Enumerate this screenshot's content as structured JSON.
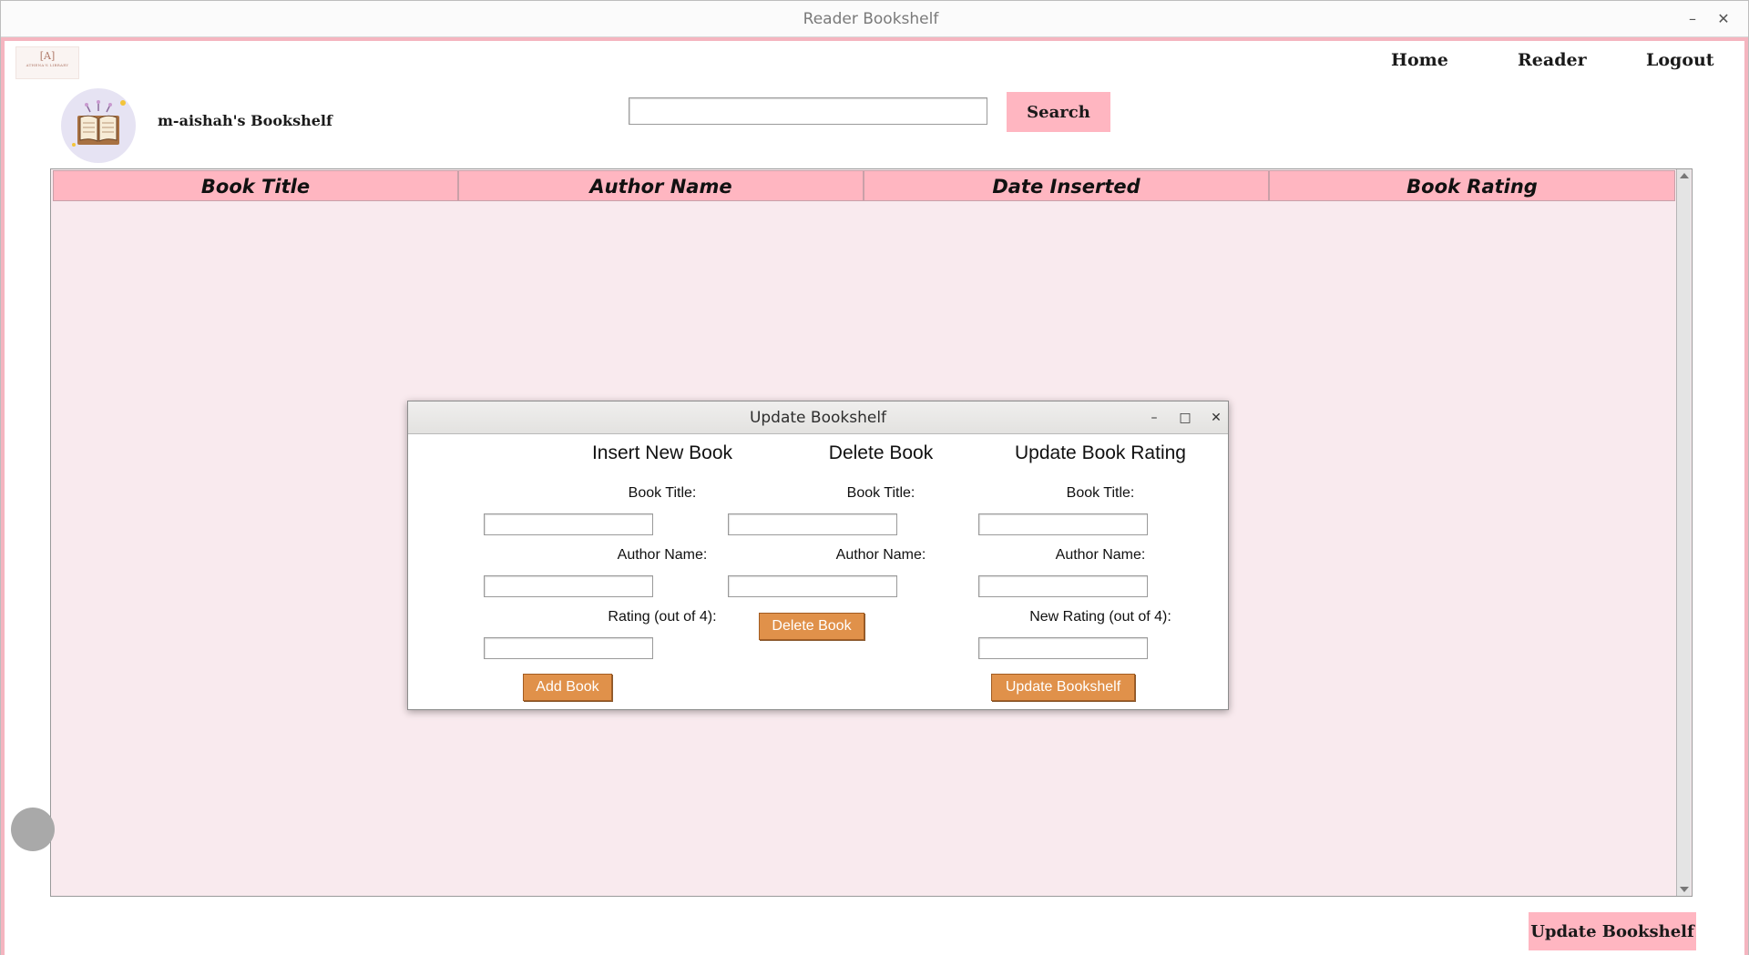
{
  "window": {
    "title": "Reader Bookshelf"
  },
  "nav": {
    "home": "Home",
    "reader": "Reader",
    "logout": "Logout"
  },
  "logo": {
    "mark": "[A]",
    "text": "ATHENA'S LIBRARY"
  },
  "profile": {
    "shelf_name": "m-aishah's Bookshelf"
  },
  "search": {
    "value": "",
    "placeholder": "",
    "button_label": "Search"
  },
  "table": {
    "columns": [
      "Book Title",
      "Author Name",
      "Date Inserted",
      "Book Rating"
    ],
    "rows": []
  },
  "footer": {
    "update_button_label": "Update Bookshelf"
  },
  "dialog": {
    "title": "Update Bookshelf",
    "insert": {
      "heading": "Insert New Book",
      "title_label": "Book Title:",
      "author_label": "Author Name:",
      "rating_label": "Rating (out of 4):",
      "button_label": "Add Book"
    },
    "delete": {
      "heading": "Delete Book",
      "title_label": "Book Title:",
      "author_label": "Author Name:",
      "button_label": "Delete Book"
    },
    "update": {
      "heading": "Update Book Rating",
      "title_label": "Book Title:",
      "author_label": "Author Name:",
      "rating_label": "New Rating (out of 4):",
      "button_label": "Update Bookshelf"
    }
  },
  "colors": {
    "pink_accent": "#ffb6c1",
    "table_bg": "#f9eaee",
    "action_orange": "#e0914a"
  },
  "icons": [
    "minimize-icon",
    "close-icon",
    "maximize-icon",
    "open-book-icon"
  ]
}
